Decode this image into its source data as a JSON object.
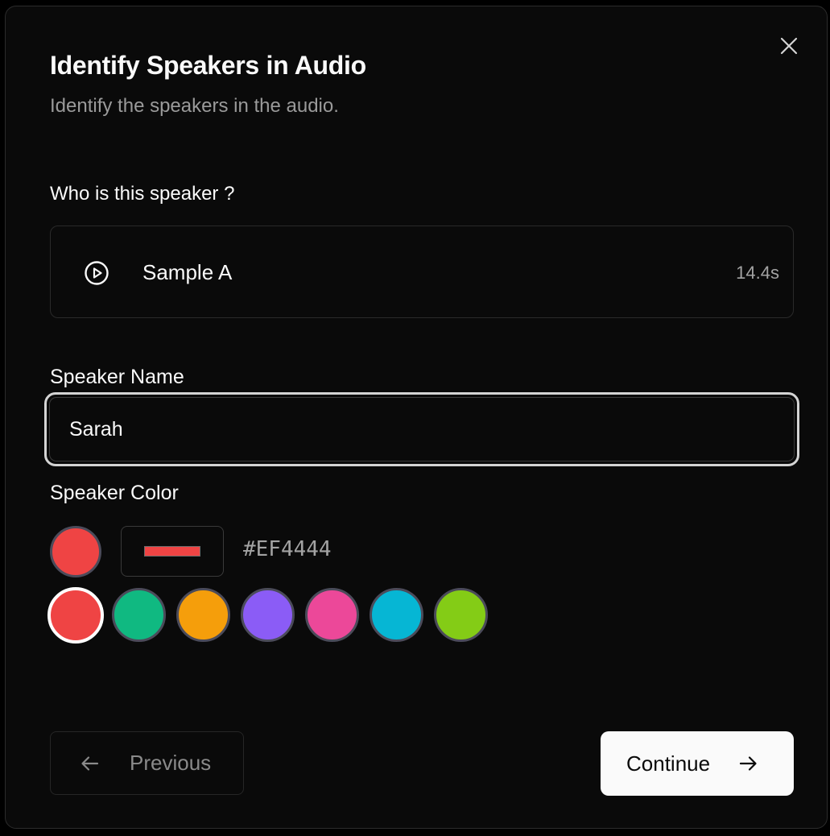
{
  "dialog": {
    "title": "Identify Speakers in Audio",
    "subtitle": "Identify the speakers in the audio.",
    "close_icon": "close-icon"
  },
  "sample": {
    "question": "Who is this speaker ?",
    "name": "Sample A",
    "duration": "14.4s",
    "play_icon": "play-circle-icon"
  },
  "speaker_name": {
    "label": "Speaker Name",
    "value": "Sarah"
  },
  "speaker_color": {
    "label": "Speaker Color",
    "selected_color": "#EF4444",
    "hex_text": "#EF4444",
    "palette": [
      "#EF4444",
      "#10B981",
      "#F59E0B",
      "#8B5CF6",
      "#EC4899",
      "#06B6D4",
      "#84CC16"
    ]
  },
  "footer": {
    "previous_label": "Previous",
    "previous_icon": "arrow-left-icon",
    "continue_label": "Continue",
    "continue_icon": "arrow-right-icon"
  }
}
